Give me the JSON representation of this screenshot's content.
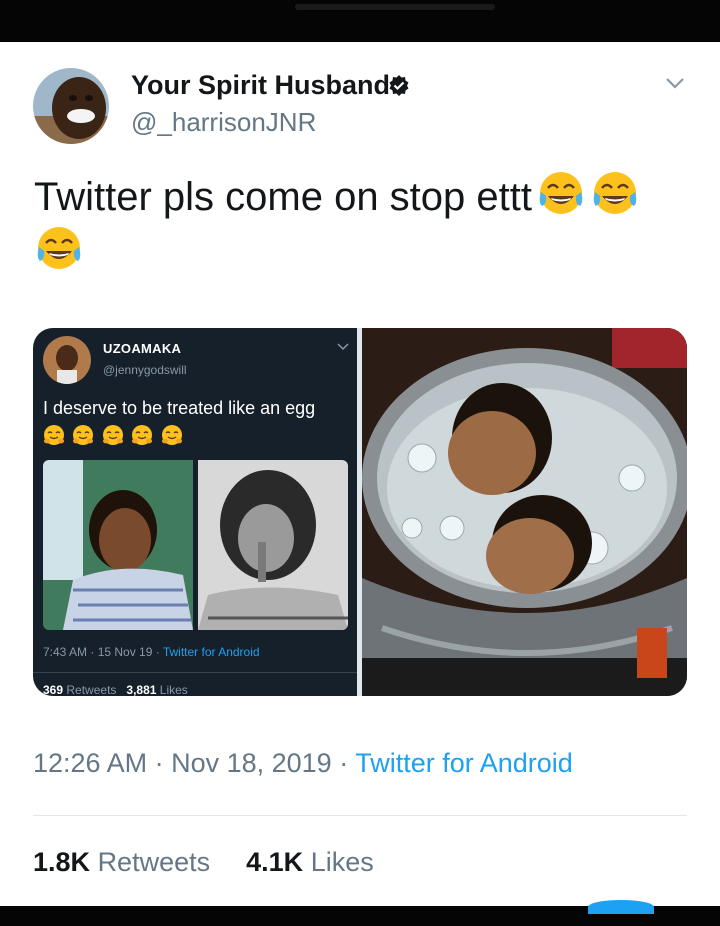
{
  "tweet": {
    "display_name": "Your Spirit Husband",
    "handle": "@_harrisonJNR",
    "text": "Twitter pls come on stop ettt",
    "emoji": "face-with-tears-of-joy",
    "time": "12:26 AM",
    "date": "Nov 18, 2019",
    "source": "Twitter for Android",
    "retweets_count": "1.8K",
    "retweets_label": "Retweets",
    "likes_count": "4.1K",
    "likes_label": "Likes"
  },
  "quoted": {
    "name": "UZOAMAKA",
    "handle": "@jennygodswill",
    "text": "I deserve to be treated like an egg",
    "emoji": "hugging-face",
    "time_date": "7:43 AM · 15 Nov 19 · ",
    "source": "Twitter for Android",
    "retweets_count": "369",
    "retweets_label": "Retweets",
    "likes_count": "3,881",
    "likes_label": "Likes"
  },
  "colors": {
    "accent": "#1da1f2",
    "text": "#14171a",
    "muted": "#657786",
    "dark_card": "#15202b"
  }
}
